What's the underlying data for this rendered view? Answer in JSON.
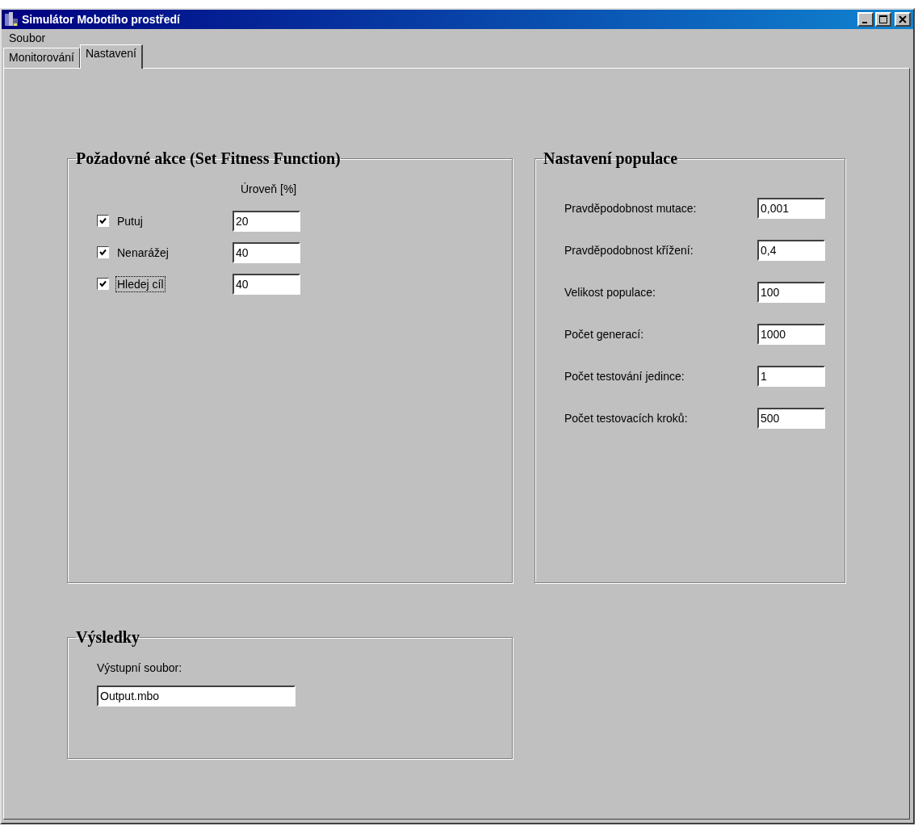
{
  "window": {
    "title": "Simulátor Mobotího prostředí"
  },
  "menu": [
    {
      "label": "Soubor"
    }
  ],
  "tabs": [
    {
      "label": "Monitorování",
      "selected": false
    },
    {
      "label": "Nastavení",
      "selected": true
    }
  ],
  "actions": {
    "title": "Požadovné akce (Set Fitness Function)",
    "column_header": "Úroveň [%]",
    "items": [
      {
        "label": "Putuj",
        "checked": true,
        "focused": false,
        "value": "20"
      },
      {
        "label": "Nenarážej",
        "checked": true,
        "focused": false,
        "value": "40"
      },
      {
        "label": "Hledej cíl",
        "checked": true,
        "focused": true,
        "value": "40"
      }
    ]
  },
  "population": {
    "title": "Nastavení populace",
    "fields": [
      {
        "label": "Pravděpodobnost mutace:",
        "value": "0,001"
      },
      {
        "label": "Pravděpodobnost křížení:",
        "value": "0,4"
      },
      {
        "label": "Velikost populace:",
        "value": "100"
      },
      {
        "label": "Počet generací:",
        "value": "1000"
      },
      {
        "label": "Počet testování jedince:",
        "value": "1"
      },
      {
        "label": "Počet testovacích kroků:",
        "value": "500"
      }
    ]
  },
  "results": {
    "title": "Výsledky",
    "label": "Výstupní soubor:",
    "value": "Output.mbo"
  }
}
